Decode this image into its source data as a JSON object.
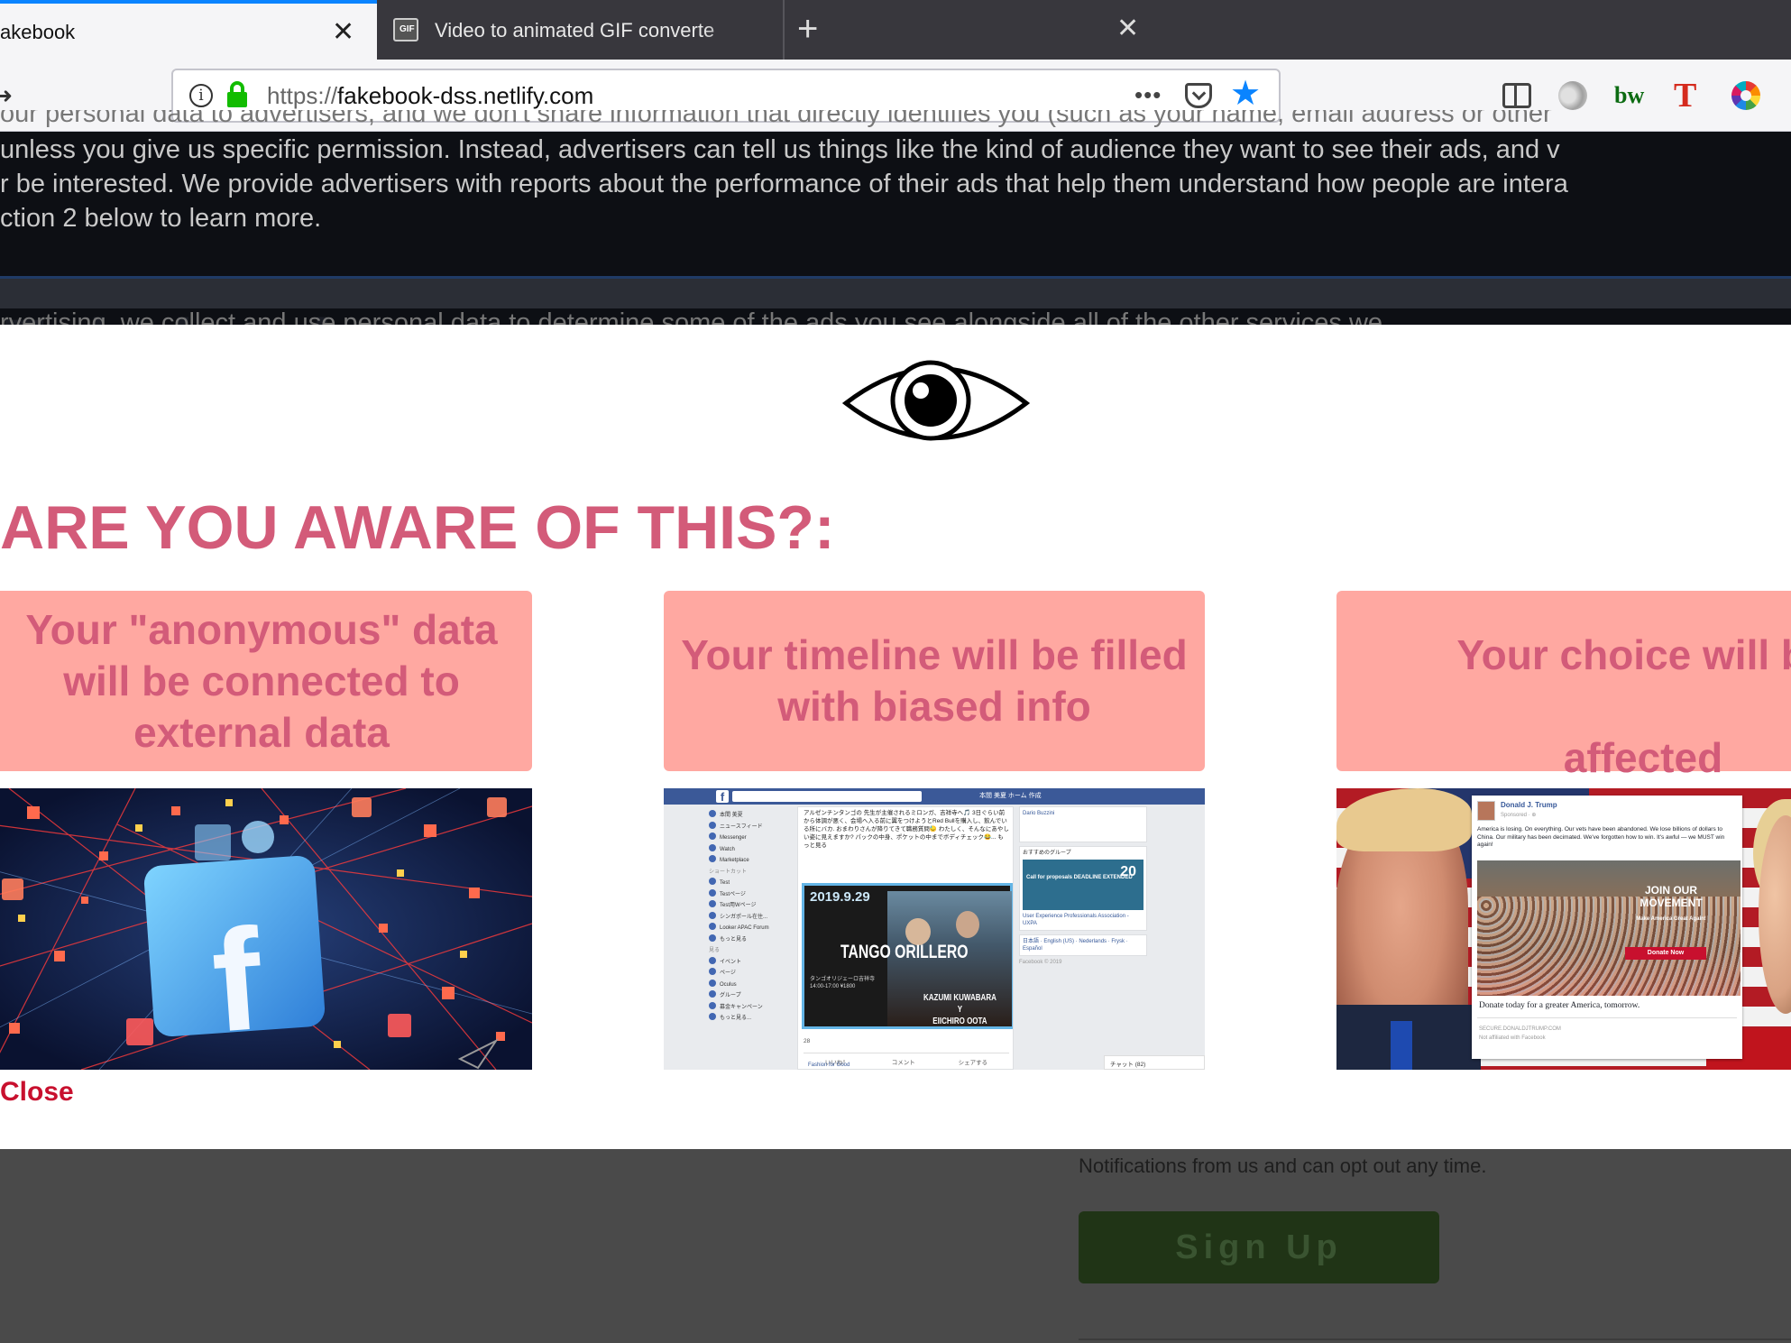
{
  "browser": {
    "tabs": [
      {
        "title": "akebook",
        "active": true,
        "close": "✕"
      },
      {
        "title": "Video to animated GIF converte",
        "active": false,
        "close": "✕"
      }
    ],
    "new_tab": "+",
    "url_scheme": "https://",
    "url_host": "fakebook-dss.netlify.com",
    "page_actions": "•••",
    "toolbar_icons": [
      "library-icon",
      "sidebar-icon",
      "ghostery-icon",
      "bw-icon",
      "t-icon",
      "color-wheel-icon"
    ],
    "bw_label": "bw",
    "t_label": "T",
    "accent_color": "#0a84ff"
  },
  "background_page": {
    "watermark": "Fakebook",
    "privacy_lines": [
      "our personal data to advertisers, and we don't share information that directly identifies you (such as your name, email address or other",
      "unless you give us specific permission. Instead, advertisers can tell us things like the kind of audience they want to see their ads, and v",
      "r be interested. We provide advertisers with reports about the performance of their ads that help them understand how people are intera",
      "ction 2 below to learn more."
    ],
    "partial_line": "rvertising, we collect and use personal data to determine some of the ads you see alongside all of the other services we",
    "notifications_text": "Notifications from us and can opt out any time.",
    "signup_label": "Sign Up"
  },
  "modal": {
    "title": "ARE YOU AWARE OF THIS?:",
    "title_color": "#d35b79",
    "cards": [
      {
        "text": "Your \"anonymous\" data will be connected to external data"
      },
      {
        "text": "Your timeline will be filled with biased info"
      },
      {
        "line1": "Your choice will be",
        "line2": "affected"
      }
    ],
    "card_color": "#ffa8a1",
    "close_label": "Close",
    "fb_screenshot": {
      "feed_text": "アルゼンチンタンゴの 先生が主催されるミロンガ、吉祥寺へ🎵 3日ぐらい前から体調が悪く、会場へ入る前に翼をつけようとRed Bullを購入し、飲んでいる所にバカ. おまわりさんが降りてきて職務質問😓 わたしく、そんなにあやしい姿に見えますか? パックの中身、ポケットの中までボディチェック😂... もっと見る",
      "poster_date": "2019.9.29",
      "poster_title": "TANGO ORILLERO",
      "poster_names": [
        "KAZUMI KUWABARA",
        "Y",
        "EIICHIRO OOTA"
      ],
      "poster_jp": "タンゴオリジェーロ吉祥寺 14:00-17:00 ¥1800",
      "nav": "本間 美夏   ホーム   作成",
      "left_items": [
        "本間 美夏",
        "ニュースフィード",
        "Messenger",
        "Watch",
        "Marketplace",
        "ショートカット",
        "Test",
        "Testページ",
        "Test用Wページ",
        "シンガポール在住...",
        "Looker APAC Forum",
        "もっと見る",
        "見る",
        "イベント",
        "ページ",
        "Oculus",
        "グループ",
        "募金キャンペーン",
        "もっと見る..."
      ],
      "actions": [
        "いいね！",
        "コメント",
        "シェアする"
      ],
      "right_group_title": "おすすめのグループ",
      "deadline": "Call for proposals DEADLINE EXTENDED",
      "deadline_num": "20",
      "right_user": "Dario Buzzini",
      "right_meta": "User Experience Professionals Association - UXPA",
      "lang": "日本語 · English (US) · Nederlands · Frysk · Español",
      "footer": "Facebook © 2019",
      "chat": "チャット (82)",
      "bottom_post": "Fashion for Good",
      "likes": "28"
    },
    "ad_screenshot": {
      "page_name": "Donald J. Trump",
      "sponsored": "Sponsored · ⊕",
      "body": "America is losing. On everything. Our vets have been abandoned. We lose billions of dollars to China. Our military has been decimated. We've forgotten how to win. It's awful — we MUST win again!",
      "join": "JOIN OUR MOVEMENT",
      "make": "Make America Great Again!",
      "donate": "Donate Now",
      "caption": "Donate today for a greater America, tomorrow.",
      "site": "SECURE.DONALDJTRUMP.COM",
      "affil": "Not affiliated with Facebook"
    }
  }
}
